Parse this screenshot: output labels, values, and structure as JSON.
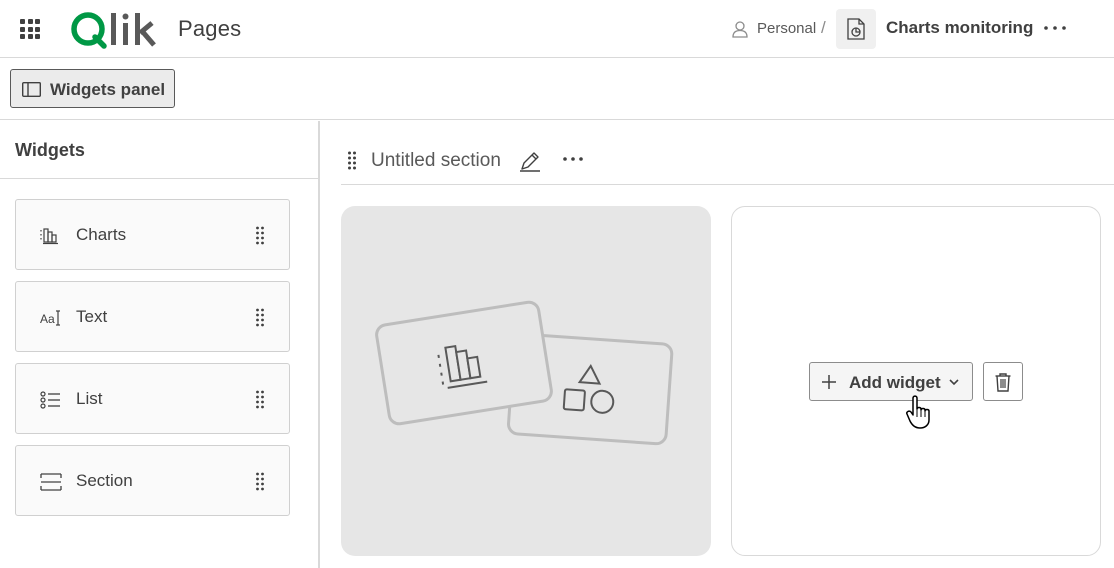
{
  "header": {
    "page_title": "Pages",
    "breadcrumb": {
      "space": "Personal",
      "separator": "/",
      "app_name": "Charts monitoring"
    },
    "icons": [
      "apps-grid-icon",
      "qlik-logo",
      "user-icon",
      "app-sheet-icon",
      "more-horizontal-icon"
    ],
    "logo_text": "Qlik",
    "logo_color": "#009845"
  },
  "toolbar": {
    "widgets_panel_label": "Widgets panel"
  },
  "sidebar": {
    "title": "Widgets",
    "items": [
      {
        "label": "Charts",
        "icon": "bar-chart-icon"
      },
      {
        "label": "Text",
        "icon": "text-icon"
      },
      {
        "label": "List",
        "icon": "list-icon"
      },
      {
        "label": "Section",
        "icon": "section-icon"
      }
    ]
  },
  "section": {
    "title": "Untitled section",
    "add_widget_label": "Add widget"
  }
}
